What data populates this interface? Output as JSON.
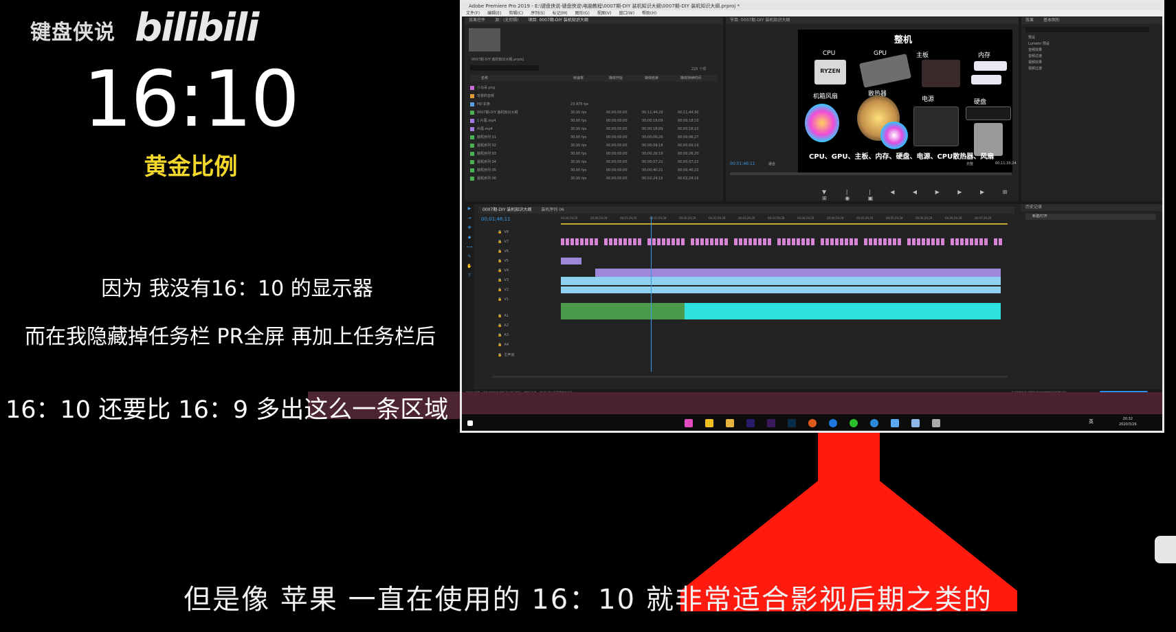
{
  "left": {
    "channel": "键盘侠说",
    "logo": "bilibili",
    "ratio": "16:10",
    "golden": "黄金比例",
    "line1": "因为 我没有16：10 的显示器",
    "line2": "而在我隐藏掉任务栏 PR全屏 再加上任务栏后",
    "line3": "16：10 还要比 16：9  多出这么一条区域"
  },
  "screen": {
    "title": "Adobe Premiere Pro 2019 - E:\\键盘侠说-键盘侠说\\电脑教程\\0007期-DIY 装机知识大纲\\0007期-DIY 装机知识大纲.prproj *",
    "menus": [
      "文件(F)",
      "编辑(E)",
      "剪辑(C)",
      "序列(S)",
      "标记(M)",
      "图形(G)",
      "视图(V)",
      "窗口(W)",
      "帮助(H)"
    ],
    "project_tabs": [
      "效果控件",
      "源：(无剪辑)",
      "项目: 0007期-DIY 装机知识大纲"
    ],
    "project_file": "0007期-DIY 装机知识大纲.prproj",
    "items_count": "225 个项",
    "columns": [
      "名称",
      "帧速率",
      "媒体开始",
      "媒体结束",
      "媒体持续时间"
    ],
    "rows": [
      {
        "name": "小马哥.png",
        "color": "#c96ad6",
        "fps": "",
        "start": "",
        "end": "",
        "dur": ""
      },
      {
        "name": "背景的音频",
        "color": "#e39b3a",
        "fps": "",
        "start": "",
        "end": "",
        "dur": ""
      },
      {
        "name": "HD 彩条",
        "color": "#5aa0e0",
        "fps": "23.976 fps",
        "start": "",
        "end": "",
        "dur": ""
      },
      {
        "name": "0007期-DIY 装机知识大纲",
        "color": "#4caf50",
        "fps": "30.00 fps",
        "start": "00;00;00;00",
        "end": "00;11;44;29",
        "dur": "00;11;44;30"
      },
      {
        "name": "1 片尾.mp4",
        "color": "#a47ce0",
        "fps": "30.00 fps",
        "start": "00;00;00;00",
        "end": "00;00;18;09",
        "dur": "00;00;18;10"
      },
      {
        "name": "片尾.mp4",
        "color": "#a47ce0",
        "fps": "30.00 fps",
        "start": "00;00;00;00",
        "end": "00;00;18;09",
        "dur": "00;00;18;10"
      },
      {
        "name": "装机序列 01",
        "color": "#4caf50",
        "fps": "30.00 fps",
        "start": "00;00;00;00",
        "end": "00;00;06;26",
        "dur": "00;00;06;27"
      },
      {
        "name": "装机序列 02",
        "color": "#4caf50",
        "fps": "30.00 fps",
        "start": "00;00;00;00",
        "end": "00;00;09;18",
        "dur": "00;00;09;19"
      },
      {
        "name": "装机序列 03",
        "color": "#4caf50",
        "fps": "30.00 fps",
        "start": "00;00;00;00",
        "end": "00;00;26;19",
        "dur": "00;00;26;20"
      },
      {
        "name": "装机序列 04",
        "color": "#4caf50",
        "fps": "30.00 fps",
        "start": "00;00;00;00",
        "end": "00;00;07;21",
        "dur": "00;00;07;22"
      },
      {
        "name": "装机序列 05",
        "color": "#4caf50",
        "fps": "30.00 fps",
        "start": "00;00;00;00",
        "end": "00;00;40;21",
        "dur": "00;00;40;22"
      },
      {
        "name": "装机序列 06",
        "color": "#4caf50",
        "fps": "30.00 fps",
        "start": "00;00;00;00",
        "end": "00;02;24;15",
        "dur": "00;02;24;16"
      }
    ],
    "program_tab": "节目: 0007期-DIY 装机知识大纲",
    "video": {
      "heading": "整机",
      "labels": [
        "CPU",
        "GPU",
        "主板",
        "内存",
        "机箱风扇",
        "散热器",
        "电源",
        "硬盘"
      ],
      "chip": "RYZEN",
      "bottom": "CPU、GPU、主板、内存、硬盘、电源、CPU散热器、风扇"
    },
    "program_time": "00;01;46;11",
    "fit": "适合",
    "full": "完整",
    "program_duration": "00;11;33;24",
    "effects_tabs": [
      "效果",
      "基本图形"
    ],
    "effects_items": [
      "预设",
      "Lumetri 预设",
      "音频效果",
      "音频过渡",
      "视频效果",
      "视频过渡"
    ],
    "timeline_tab": "0007期-DIY 装机知识大纲",
    "timeline_tab2": "装机序列 06",
    "timeline_time": "00;01;46;11",
    "ruler": [
      "00;00;29;29",
      "00;00;59;28",
      "00;01;29;29",
      "00;01;59;28",
      "00;02;29;29",
      "00;02;59;28",
      "00;03;29;29",
      "00;03;59;28",
      "00;04;29;29",
      "00;04;59;28",
      "00;05;29;29",
      "00;05;59;28",
      "00;06;29;29",
      "00;06;59;28",
      "00;07;29;29"
    ],
    "track_labels": [
      "V8",
      "V7",
      "V6",
      "V5",
      "V4",
      "V3",
      "V2",
      "V1",
      "A1",
      "A2",
      "A3",
      "A4",
      "主声道"
    ],
    "history_tab": "历史记录",
    "history_item": "新建/打开",
    "status_left": "单击以选择，或单击空白处并拖动以进行框选。使用 Shift、Alt 和 Ctrl 可获得其他选项。",
    "status_right": "E:\\键盘侠说-键盘侠说\\电脑教程\\0007期-DIY",
    "clock_time": "20:32",
    "clock_date": "2020/3/26",
    "ime": "英"
  },
  "subtitle": "但是像 苹果 一直在使用的 16：10 就非常适合影视后期之类的",
  "colors": {
    "golden": "#f3d72a",
    "stand": "#ff1a10",
    "timeline_pink": "#d883d4",
    "timeline_purple": "#9e86d8",
    "timeline_blue": "#8ed0f0",
    "timeline_cyan": "#2ee0e0",
    "timeline_green": "#4b9a4b"
  }
}
